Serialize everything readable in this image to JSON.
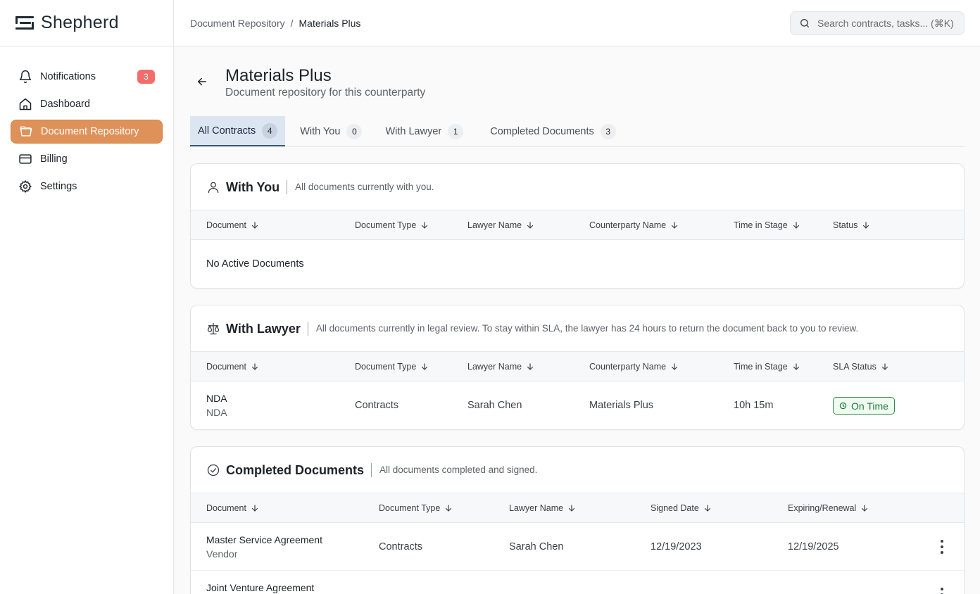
{
  "app": {
    "name": "Shepherd"
  },
  "sidebar": {
    "items": [
      {
        "label": "Notifications",
        "icon": "bell-icon",
        "badge": "3"
      },
      {
        "label": "Dashboard",
        "icon": "home-icon"
      },
      {
        "label": "Document Repository",
        "icon": "folder-icon",
        "active": true
      },
      {
        "label": "Billing",
        "icon": "credit-card-icon"
      },
      {
        "label": "Settings",
        "icon": "gear-icon"
      }
    ]
  },
  "breadcrumb": {
    "parent": "Document Repository",
    "separator": "/",
    "current": "Materials Plus"
  },
  "search": {
    "placeholder": "Search contracts, tasks... (⌘K)"
  },
  "page": {
    "title": "Materials Plus",
    "subtitle": "Document repository for this counterparty"
  },
  "tabs": [
    {
      "label": "All Contracts",
      "count": "4",
      "active": true
    },
    {
      "label": "With You",
      "count": "0"
    },
    {
      "label": "With Lawyer",
      "count": "1"
    },
    {
      "label": "Completed Documents",
      "count": "3"
    }
  ],
  "with_you": {
    "title": "With You",
    "description": "All documents currently with you.",
    "columns": [
      "Document",
      "Document Type",
      "Lawyer Name",
      "Counterparty Name",
      "Time in Stage",
      "Status"
    ],
    "empty_text": "No Active Documents"
  },
  "with_lawyer": {
    "title": "With Lawyer",
    "description": "All documents currently in legal review. To stay within SLA, the lawyer has 24 hours to return the document back to you to review.",
    "columns": [
      "Document",
      "Document Type",
      "Lawyer Name",
      "Counterparty Name",
      "Time in Stage",
      "SLA Status"
    ],
    "rows": [
      {
        "doc_name": "NDA",
        "doc_sub": "NDA",
        "type": "Contracts",
        "lawyer": "Sarah Chen",
        "counterparty": "Materials Plus",
        "time": "10h 15m",
        "sla": "On Time"
      }
    ]
  },
  "completed": {
    "title": "Completed Documents",
    "description": "All documents completed and signed.",
    "columns": [
      "Document",
      "Document Type",
      "Lawyer Name",
      "Signed Date",
      "Expiring/Renewal"
    ],
    "rows": [
      {
        "doc_name": "Master Service Agreement",
        "doc_sub": "Vendor",
        "type": "Contracts",
        "lawyer": "Sarah Chen",
        "signed": "12/19/2023",
        "expiring": "12/19/2025"
      },
      {
        "doc_name": "Joint Venture Agreement",
        "doc_sub": "",
        "type": "",
        "lawyer": "",
        "signed": "",
        "expiring": ""
      }
    ]
  },
  "colors": {
    "accent": "#de9158",
    "badge": "#f46b6b",
    "tab_active_bg": "#dce6f2",
    "status_green": "#1f7a3d"
  }
}
